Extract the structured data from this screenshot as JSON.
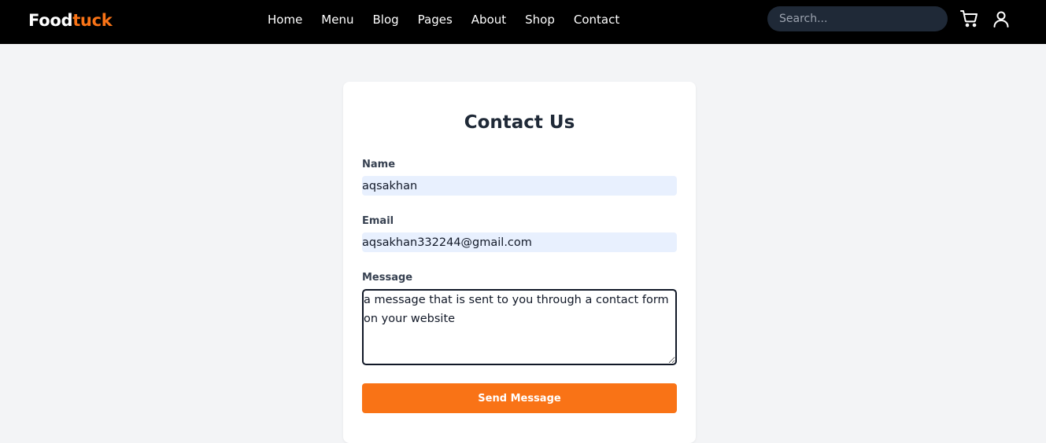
{
  "brand": {
    "part1": "Food",
    "part2": "tuck",
    "accent": "#f97316"
  },
  "nav": {
    "links": [
      "Home",
      "Menu",
      "Blog",
      "Pages",
      "About",
      "Shop",
      "Contact"
    ]
  },
  "search": {
    "placeholder": "Search...",
    "value": ""
  },
  "header_icons": {
    "cart": "cart-icon",
    "user": "user-icon"
  },
  "form": {
    "title": "Contact Us",
    "name_label": "Name",
    "name_value": "aqsakhan",
    "email_label": "Email",
    "email_value": "aqsakhan332244@gmail.com",
    "message_label": "Message",
    "message_value": "a message that is sent to you through a contact form on your website",
    "submit_label": "Send Message"
  }
}
